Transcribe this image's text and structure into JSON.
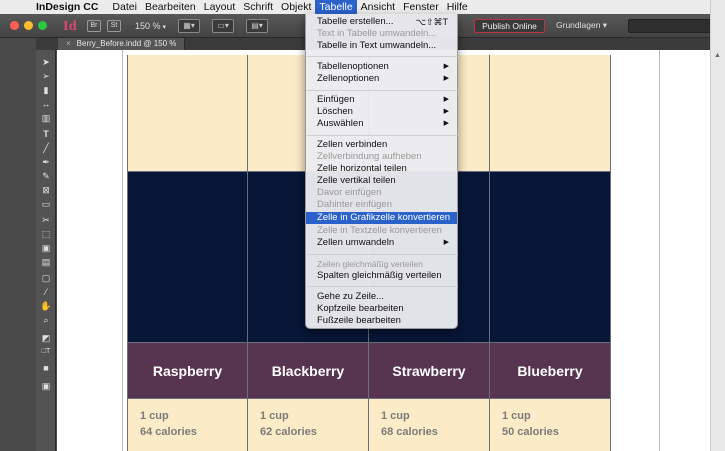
{
  "menubar": {
    "app_name": "InDesign CC",
    "items": [
      "Datei",
      "Bearbeiten",
      "Layout",
      "Schrift",
      "Objekt",
      "Tabelle",
      "Ansicht",
      "Fenster",
      "Hilfe"
    ],
    "active": "Tabelle"
  },
  "appbar": {
    "logo": "Id",
    "btn_a": "Br",
    "btn_b": "St",
    "zoom": "150 %",
    "publish_label": "Publish Online",
    "workspace_label": "Grundlagen"
  },
  "document_tab": {
    "label": "Berry_Before.indd @ 150 %"
  },
  "menu": {
    "items": [
      {
        "label": "Tabelle erstellen...",
        "shortcut": "⌥⇧⌘T",
        "enabled": true
      },
      {
        "label": "Text in Tabelle umwandeln...",
        "enabled": false
      },
      {
        "label": "Tabelle in Text umwandeln...",
        "enabled": true
      },
      {
        "label": "Tabellenoptionen",
        "submenu": true,
        "enabled": true
      },
      {
        "label": "Zellenoptionen",
        "submenu": true,
        "enabled": true
      },
      {
        "label": "Einfügen",
        "submenu": true,
        "enabled": true
      },
      {
        "label": "Löschen",
        "submenu": true,
        "enabled": true
      },
      {
        "label": "Auswählen",
        "submenu": true,
        "enabled": true
      },
      {
        "label": "Zellen verbinden",
        "enabled": true
      },
      {
        "label": "Zellverbindung aufheben",
        "enabled": false
      },
      {
        "label": "Zelle horizontal teilen",
        "enabled": true
      },
      {
        "label": "Zelle vertikal teilen",
        "enabled": true
      },
      {
        "label": "Davor einfügen",
        "enabled": false
      },
      {
        "label": "Dahinter einfügen",
        "enabled": false
      },
      {
        "label": "Zelle in Grafikzelle konvertieren",
        "enabled": true,
        "highlighted": true
      },
      {
        "label": "Zelle in Textzelle konvertieren",
        "enabled": false
      },
      {
        "label": "Zellen umwandeln",
        "submenu": true,
        "enabled": true
      },
      {
        "label": "Zeilen gleichmäßig verteilen",
        "enabled": false
      },
      {
        "label": "Spalten gleichmäßig verteilen",
        "enabled": true
      },
      {
        "label": "Gehe zu Zeile...",
        "enabled": true
      },
      {
        "label": "Kopfzeile bearbeiten",
        "enabled": true
      },
      {
        "label": "Fußzeile bearbeiten",
        "enabled": true
      }
    ],
    "highlight_color": "#2a62c9"
  },
  "table": {
    "columns": [
      {
        "name": "Raspberry",
        "amount": "1 cup",
        "calories": "64 calories"
      },
      {
        "name": "Blackberry",
        "amount": "1 cup",
        "calories": "62 calories"
      },
      {
        "name": "Strawberry",
        "amount": "1 cup",
        "calories": "68 calories"
      },
      {
        "name": "Blueberry",
        "amount": "1 cup",
        "calories": "50 calories"
      }
    ],
    "colors": {
      "cream": "#fbecc7",
      "navy": "#081638",
      "plum": "#57344f"
    }
  },
  "icons": [
    "apple-icon",
    "selection-tool-icon",
    "direct-selection-tool-icon",
    "page-tool-icon",
    "gap-tool-icon",
    "content-collector-icon",
    "type-tool-icon",
    "line-tool-icon",
    "pen-tool-icon",
    "pencil-tool-icon",
    "rectangle-frame-tool-icon",
    "rectangle-tool-icon",
    "scissors-tool-icon",
    "free-transform-tool-icon",
    "gradient-swatch-tool-icon",
    "gradient-feather-tool-icon",
    "note-tool-icon",
    "eyedropper-tool-icon",
    "hand-tool-icon",
    "zoom-tool-icon",
    "fill-stroke-icon",
    "screen-mode-icon"
  ]
}
